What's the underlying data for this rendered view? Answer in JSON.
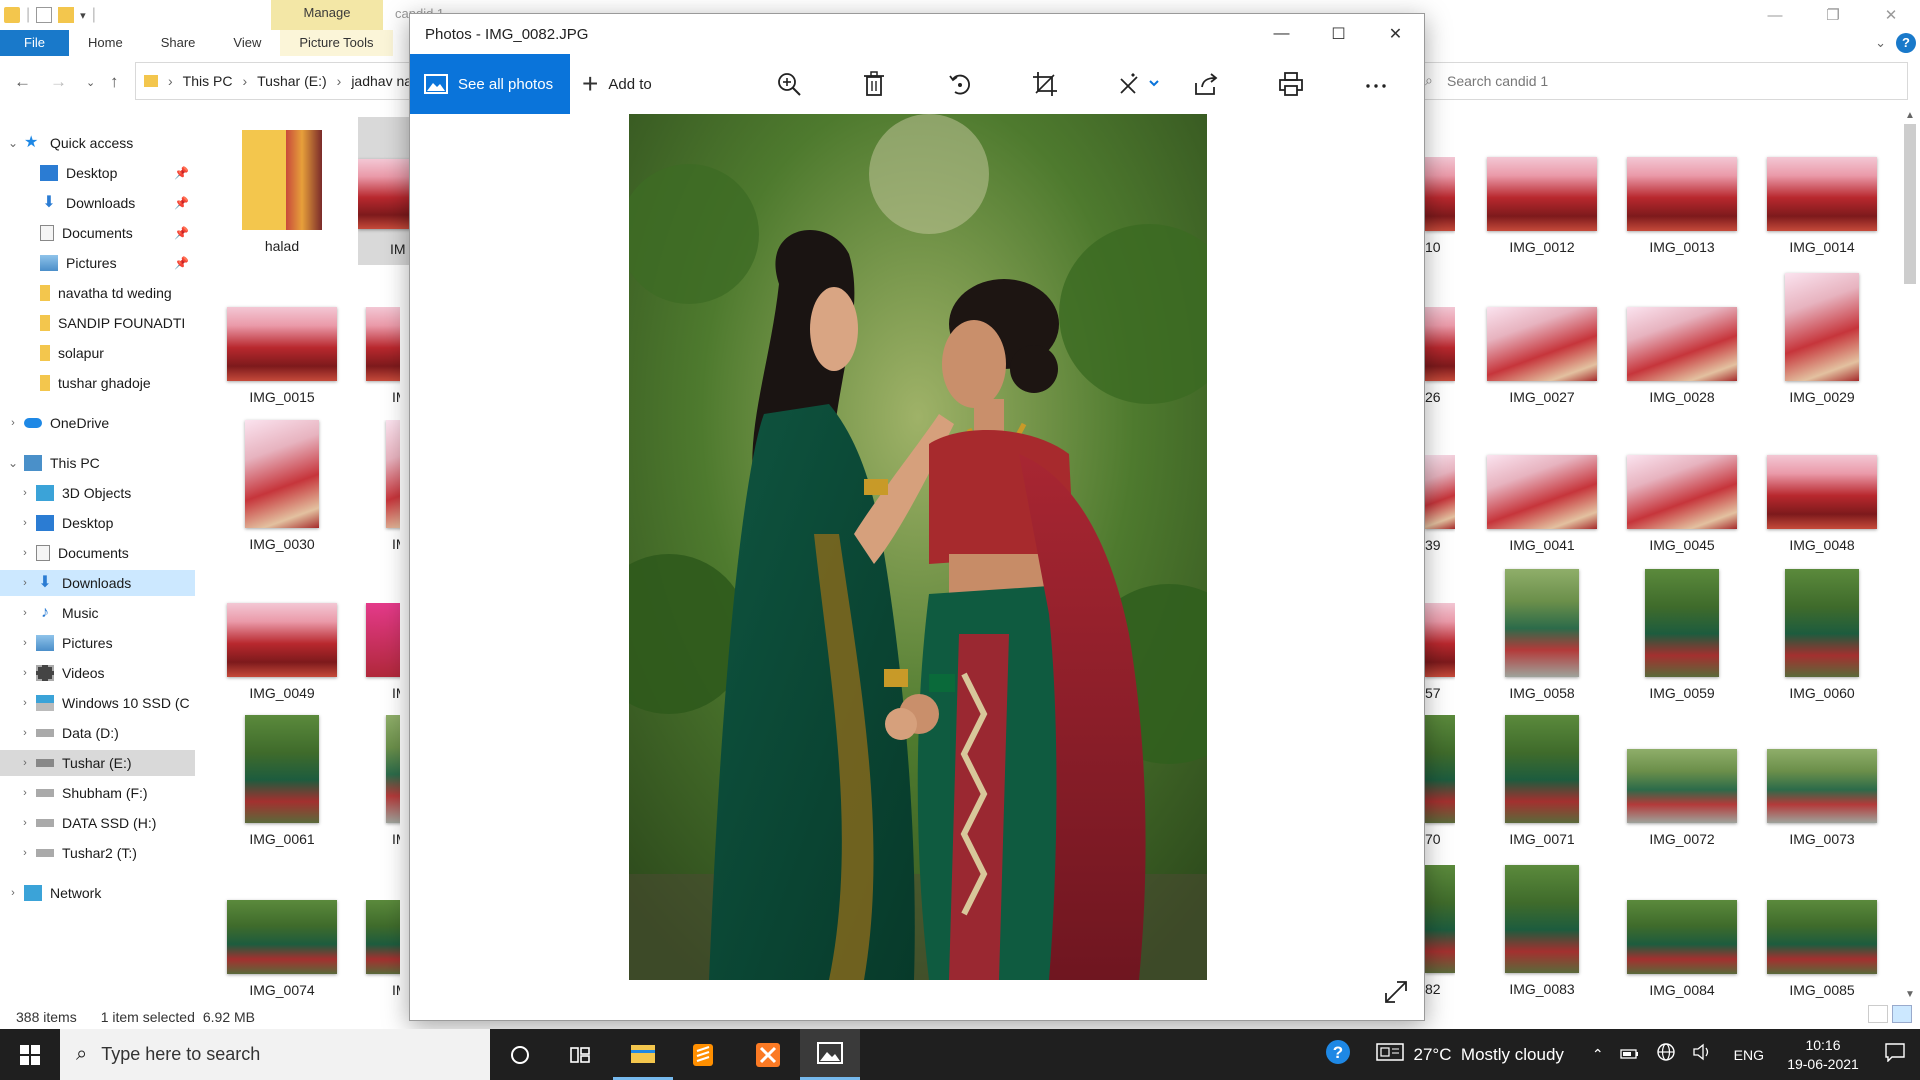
{
  "explorer": {
    "ribbon_context_tab": "Manage",
    "window_title": "candid 1",
    "tabs": [
      "File",
      "Home",
      "Share",
      "View",
      "Picture Tools"
    ],
    "address": {
      "crumbs": [
        "This PC",
        "Tushar (E:)",
        "jadhav na"
      ]
    },
    "search_placeholder": "Search candid 1",
    "nav": {
      "quick_access": "Quick access",
      "quick_items": [
        "Desktop",
        "Downloads",
        "Documents",
        "Pictures",
        "navatha td weding",
        "SANDIP FOUNADTI",
        "solapur",
        "tushar ghadoje"
      ],
      "onedrive": "OneDrive",
      "this_pc": "This PC",
      "pc_items": [
        "3D Objects",
        "Desktop",
        "Documents",
        "Downloads",
        "Music",
        "Pictures",
        "Videos",
        "Windows 10 SSD (C",
        "Data (D:)",
        "Tushar (E:)",
        "Shubham (F:)",
        "DATA SSD (H:)",
        "Tushar2 (T:)"
      ],
      "network": "Network"
    },
    "left_thumbs": [
      {
        "name": "halad"
      },
      {
        "name": "IM"
      },
      {
        "name": "IMG_0015"
      },
      {
        "name": "IM"
      },
      {
        "name": "IMG_0030"
      },
      {
        "name": "IM"
      },
      {
        "name": "IMG_0049"
      },
      {
        "name": "IM"
      },
      {
        "name": "IMG_0061"
      },
      {
        "name": "IM"
      },
      {
        "name": "IMG_0074"
      },
      {
        "name": "IM"
      }
    ],
    "right_partial_labels": [
      "10",
      "26",
      "39",
      "57",
      "70",
      "82"
    ],
    "right_thumbs": [
      [
        "IMG_0012",
        "IMG_0013",
        "IMG_0014"
      ],
      [
        "IMG_0027",
        "IMG_0028",
        "IMG_0029"
      ],
      [
        "IMG_0041",
        "IMG_0045",
        "IMG_0048"
      ],
      [
        "IMG_0058",
        "IMG_0059",
        "IMG_0060"
      ],
      [
        "IMG_0071",
        "IMG_0072",
        "IMG_0073"
      ],
      [
        "IMG_0083",
        "IMG_0084",
        "IMG_0085"
      ]
    ],
    "status": {
      "count": "388 items",
      "selected": "1 item selected",
      "size": "6.92 MB"
    }
  },
  "photos": {
    "title": "Photos - IMG_0082.JPG",
    "see_all": "See all photos",
    "add_to": "Add to",
    "toolbar_icons": [
      "zoom-icon",
      "delete-icon",
      "rotate-icon",
      "crop-icon",
      "edit-icon",
      "share-icon",
      "print-icon",
      "more-icon"
    ]
  },
  "taskbar": {
    "search_placeholder": "Type here to search",
    "weather": "27°C  Mostly cloudy",
    "lang": "ENG",
    "time": "10:16",
    "date": "19-06-2021"
  }
}
